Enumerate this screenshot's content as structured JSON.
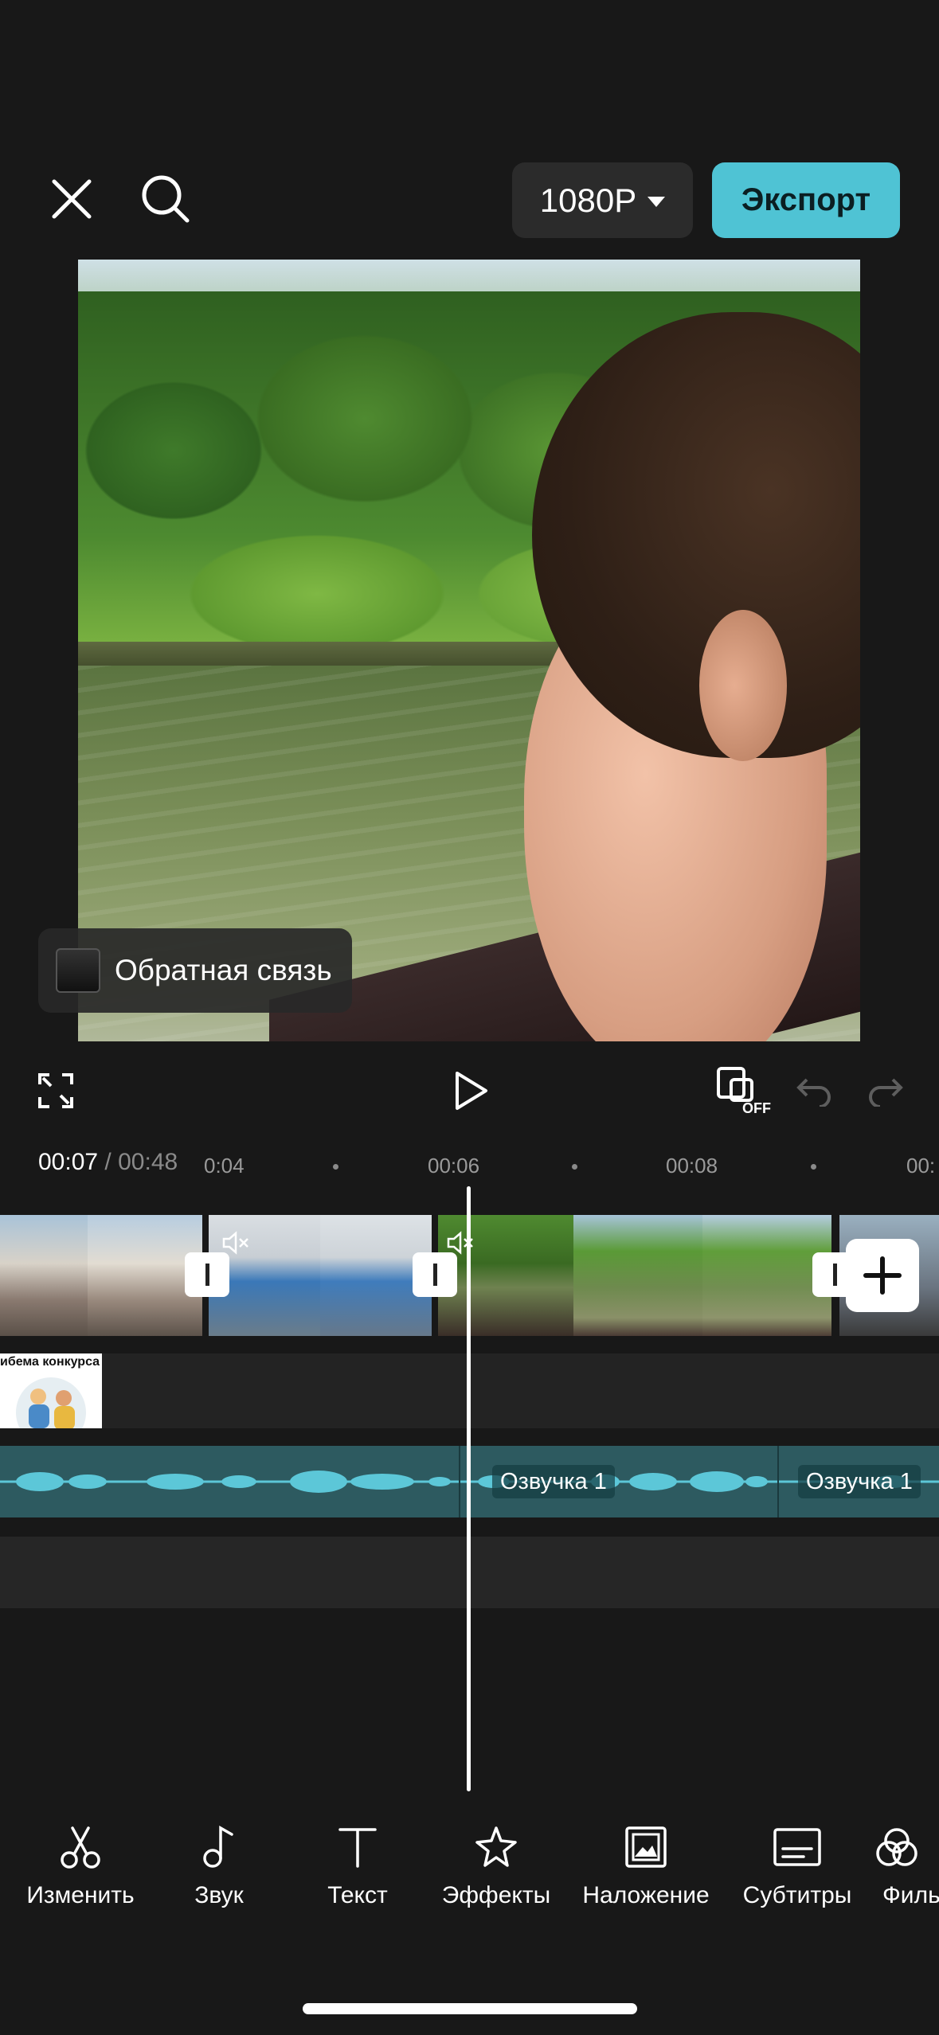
{
  "header": {
    "resolution": "1080P",
    "export": "Экспорт"
  },
  "preview": {
    "feedback": "Обратная связь"
  },
  "controls": {
    "cover_off": "OFF"
  },
  "timeline": {
    "current_time": "00:07",
    "separator": "/",
    "total_time": "00:48",
    "ruler": [
      "0:04",
      "00:06",
      "00:08",
      "00:"
    ],
    "sticker_caption": "ибема конкурса",
    "audio_labels": [
      "Озвучка 1",
      "Озвучка 1"
    ]
  },
  "toolbar": {
    "items": [
      {
        "label": "Изменить",
        "icon": "scissors-icon"
      },
      {
        "label": "Звук",
        "icon": "music-note-icon"
      },
      {
        "label": "Текст",
        "icon": "text-icon"
      },
      {
        "label": "Эффекты",
        "icon": "effects-star-icon"
      },
      {
        "label": "Наложение",
        "icon": "overlay-image-icon"
      },
      {
        "label": "Субтитры",
        "icon": "subtitles-icon"
      },
      {
        "label": "Филь",
        "icon": "filters-icon"
      }
    ]
  },
  "colors": {
    "accent": "#4fc3d4",
    "background": "#181818",
    "audio_track": "#2d5a60"
  }
}
